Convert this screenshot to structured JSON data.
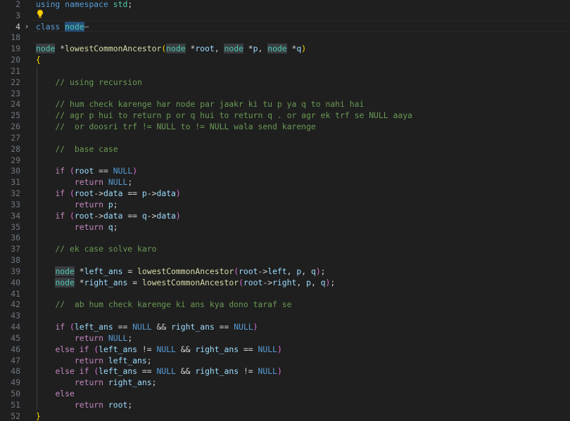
{
  "editor": {
    "accent_keyword": "#569cd6",
    "accent_comment": "#6a9955",
    "accent_type": "#4ec9b0",
    "accent_function": "#dcdcaa",
    "accent_variable": "#9cdcfe"
  },
  "lines": [
    {
      "n": "2",
      "tokens": [
        [
          "kw",
          "using"
        ],
        [
          "plain",
          " "
        ],
        [
          "kw",
          "namespace"
        ],
        [
          "plain",
          " "
        ],
        [
          "ty",
          "std"
        ],
        [
          "plain",
          ";"
        ]
      ]
    },
    {
      "n": "3",
      "tokens": []
    },
    {
      "n": "4",
      "tokens": [
        [
          "kw",
          "class"
        ],
        [
          "plain",
          " "
        ],
        [
          "tysel",
          "node"
        ],
        [
          "ell",
          "⋯"
        ]
      ],
      "fold": "›",
      "active": true
    },
    {
      "n": "18",
      "tokens": []
    },
    {
      "n": "19",
      "tokens": [
        [
          "tyhl",
          "node"
        ],
        [
          "plain",
          " "
        ],
        [
          "op",
          "*"
        ],
        [
          "fn",
          "lowestCommonAncestor"
        ],
        [
          "br",
          "("
        ],
        [
          "tyhl",
          "node"
        ],
        [
          "plain",
          " "
        ],
        [
          "op",
          "*"
        ],
        [
          "var",
          "root"
        ],
        [
          "plain",
          ", "
        ],
        [
          "tyhl",
          "node"
        ],
        [
          "plain",
          " "
        ],
        [
          "op",
          "*"
        ],
        [
          "var",
          "p"
        ],
        [
          "plain",
          ", "
        ],
        [
          "tyhl",
          "node"
        ],
        [
          "plain",
          " "
        ],
        [
          "op",
          "*"
        ],
        [
          "var",
          "q"
        ],
        [
          "br",
          ")"
        ]
      ]
    },
    {
      "n": "20",
      "tokens": [
        [
          "br",
          "{"
        ]
      ]
    },
    {
      "n": "21",
      "tokens": []
    },
    {
      "n": "22",
      "tokens": [
        [
          "plain",
          "    "
        ],
        [
          "cm",
          "// using recursion"
        ]
      ]
    },
    {
      "n": "23",
      "tokens": []
    },
    {
      "n": "24",
      "tokens": [
        [
          "plain",
          "    "
        ],
        [
          "cm",
          "// hum check karenge har node par jaakr ki tu p ya q to nahi hai"
        ]
      ]
    },
    {
      "n": "25",
      "tokens": [
        [
          "plain",
          "    "
        ],
        [
          "cm",
          "// agr p hui to return p or q hui to return q . or agr ek trf se NULL aaya"
        ]
      ]
    },
    {
      "n": "26",
      "tokens": [
        [
          "plain",
          "    "
        ],
        [
          "cm",
          "//  or doosri trf != NULL to != NULL wala send karenge"
        ]
      ]
    },
    {
      "n": "27",
      "tokens": []
    },
    {
      "n": "28",
      "tokens": [
        [
          "plain",
          "    "
        ],
        [
          "cm",
          "//  base case"
        ]
      ]
    },
    {
      "n": "29",
      "tokens": []
    },
    {
      "n": "30",
      "tokens": [
        [
          "plain",
          "    "
        ],
        [
          "ctl",
          "if"
        ],
        [
          "plain",
          " "
        ],
        [
          "br2",
          "("
        ],
        [
          "var",
          "root"
        ],
        [
          "plain",
          " "
        ],
        [
          "op",
          "=="
        ],
        [
          "plain",
          " "
        ],
        [
          "kw",
          "NULL"
        ],
        [
          "br2",
          ")"
        ]
      ]
    },
    {
      "n": "31",
      "tokens": [
        [
          "plain",
          "        "
        ],
        [
          "ctl",
          "return"
        ],
        [
          "plain",
          " "
        ],
        [
          "kw",
          "NULL"
        ],
        [
          "plain",
          ";"
        ]
      ]
    },
    {
      "n": "32",
      "tokens": [
        [
          "plain",
          "    "
        ],
        [
          "ctl",
          "if"
        ],
        [
          "plain",
          " "
        ],
        [
          "br2",
          "("
        ],
        [
          "var",
          "root"
        ],
        [
          "op",
          "->"
        ],
        [
          "var",
          "data"
        ],
        [
          "plain",
          " "
        ],
        [
          "op",
          "=="
        ],
        [
          "plain",
          " "
        ],
        [
          "var",
          "p"
        ],
        [
          "op",
          "->"
        ],
        [
          "var",
          "data"
        ],
        [
          "br2",
          ")"
        ]
      ]
    },
    {
      "n": "33",
      "tokens": [
        [
          "plain",
          "        "
        ],
        [
          "ctl",
          "return"
        ],
        [
          "plain",
          " "
        ],
        [
          "var",
          "p"
        ],
        [
          "plain",
          ";"
        ]
      ]
    },
    {
      "n": "34",
      "tokens": [
        [
          "plain",
          "    "
        ],
        [
          "ctl",
          "if"
        ],
        [
          "plain",
          " "
        ],
        [
          "br2",
          "("
        ],
        [
          "var",
          "root"
        ],
        [
          "op",
          "->"
        ],
        [
          "var",
          "data"
        ],
        [
          "plain",
          " "
        ],
        [
          "op",
          "=="
        ],
        [
          "plain",
          " "
        ],
        [
          "var",
          "q"
        ],
        [
          "op",
          "->"
        ],
        [
          "var",
          "data"
        ],
        [
          "br2",
          ")"
        ]
      ]
    },
    {
      "n": "35",
      "tokens": [
        [
          "plain",
          "        "
        ],
        [
          "ctl",
          "return"
        ],
        [
          "plain",
          " "
        ],
        [
          "var",
          "q"
        ],
        [
          "plain",
          ";"
        ]
      ]
    },
    {
      "n": "36",
      "tokens": []
    },
    {
      "n": "37",
      "tokens": [
        [
          "plain",
          "    "
        ],
        [
          "cm",
          "// ek case solve karo"
        ]
      ]
    },
    {
      "n": "38",
      "tokens": []
    },
    {
      "n": "39",
      "tokens": [
        [
          "plain",
          "    "
        ],
        [
          "tyhl",
          "node"
        ],
        [
          "plain",
          " "
        ],
        [
          "op",
          "*"
        ],
        [
          "var",
          "left_ans"
        ],
        [
          "plain",
          " "
        ],
        [
          "op",
          "="
        ],
        [
          "plain",
          " "
        ],
        [
          "fn",
          "lowestCommonAncestor"
        ],
        [
          "br2",
          "("
        ],
        [
          "var",
          "root"
        ],
        [
          "op",
          "->"
        ],
        [
          "var",
          "left"
        ],
        [
          "plain",
          ", "
        ],
        [
          "var",
          "p"
        ],
        [
          "plain",
          ", "
        ],
        [
          "var",
          "q"
        ],
        [
          "br2",
          ")"
        ],
        [
          "plain",
          ";"
        ]
      ]
    },
    {
      "n": "40",
      "tokens": [
        [
          "plain",
          "    "
        ],
        [
          "tyhl",
          "node"
        ],
        [
          "plain",
          " "
        ],
        [
          "op",
          "*"
        ],
        [
          "var",
          "right_ans"
        ],
        [
          "plain",
          " "
        ],
        [
          "op",
          "="
        ],
        [
          "plain",
          " "
        ],
        [
          "fn",
          "lowestCommonAncestor"
        ],
        [
          "br2",
          "("
        ],
        [
          "var",
          "root"
        ],
        [
          "op",
          "->"
        ],
        [
          "var",
          "right"
        ],
        [
          "plain",
          ", "
        ],
        [
          "var",
          "p"
        ],
        [
          "plain",
          ", "
        ],
        [
          "var",
          "q"
        ],
        [
          "br2",
          ")"
        ],
        [
          "plain",
          ";"
        ]
      ]
    },
    {
      "n": "41",
      "tokens": []
    },
    {
      "n": "42",
      "tokens": [
        [
          "plain",
          "    "
        ],
        [
          "cm",
          "//  ab hum check karenge ki ans kya dono taraf se"
        ]
      ]
    },
    {
      "n": "43",
      "tokens": []
    },
    {
      "n": "44",
      "tokens": [
        [
          "plain",
          "    "
        ],
        [
          "ctl",
          "if"
        ],
        [
          "plain",
          " "
        ],
        [
          "br2",
          "("
        ],
        [
          "var",
          "left_ans"
        ],
        [
          "plain",
          " "
        ],
        [
          "op",
          "=="
        ],
        [
          "plain",
          " "
        ],
        [
          "kw",
          "NULL"
        ],
        [
          "plain",
          " "
        ],
        [
          "op",
          "&&"
        ],
        [
          "plain",
          " "
        ],
        [
          "var",
          "right_ans"
        ],
        [
          "plain",
          " "
        ],
        [
          "op",
          "=="
        ],
        [
          "plain",
          " "
        ],
        [
          "kw",
          "NULL"
        ],
        [
          "br2",
          ")"
        ]
      ]
    },
    {
      "n": "45",
      "tokens": [
        [
          "plain",
          "        "
        ],
        [
          "ctl",
          "return"
        ],
        [
          "plain",
          " "
        ],
        [
          "kw",
          "NULL"
        ],
        [
          "plain",
          ";"
        ]
      ]
    },
    {
      "n": "46",
      "tokens": [
        [
          "plain",
          "    "
        ],
        [
          "ctl",
          "else"
        ],
        [
          "plain",
          " "
        ],
        [
          "ctl",
          "if"
        ],
        [
          "plain",
          " "
        ],
        [
          "br2",
          "("
        ],
        [
          "var",
          "left_ans"
        ],
        [
          "plain",
          " "
        ],
        [
          "op",
          "!="
        ],
        [
          "plain",
          " "
        ],
        [
          "kw",
          "NULL"
        ],
        [
          "plain",
          " "
        ],
        [
          "op",
          "&&"
        ],
        [
          "plain",
          " "
        ],
        [
          "var",
          "right_ans"
        ],
        [
          "plain",
          " "
        ],
        [
          "op",
          "=="
        ],
        [
          "plain",
          " "
        ],
        [
          "kw",
          "NULL"
        ],
        [
          "br2",
          ")"
        ]
      ]
    },
    {
      "n": "47",
      "tokens": [
        [
          "plain",
          "        "
        ],
        [
          "ctl",
          "return"
        ],
        [
          "plain",
          " "
        ],
        [
          "var",
          "left_ans"
        ],
        [
          "plain",
          ";"
        ]
      ]
    },
    {
      "n": "48",
      "tokens": [
        [
          "plain",
          "    "
        ],
        [
          "ctl",
          "else"
        ],
        [
          "plain",
          " "
        ],
        [
          "ctl",
          "if"
        ],
        [
          "plain",
          " "
        ],
        [
          "br2",
          "("
        ],
        [
          "var",
          "left_ans"
        ],
        [
          "plain",
          " "
        ],
        [
          "op",
          "=="
        ],
        [
          "plain",
          " "
        ],
        [
          "kw",
          "NULL"
        ],
        [
          "plain",
          " "
        ],
        [
          "op",
          "&&"
        ],
        [
          "plain",
          " "
        ],
        [
          "var",
          "right_ans"
        ],
        [
          "plain",
          " "
        ],
        [
          "op",
          "!="
        ],
        [
          "plain",
          " "
        ],
        [
          "kw",
          "NULL"
        ],
        [
          "br2",
          ")"
        ]
      ]
    },
    {
      "n": "49",
      "tokens": [
        [
          "plain",
          "        "
        ],
        [
          "ctl",
          "return"
        ],
        [
          "plain",
          " "
        ],
        [
          "var",
          "right_ans"
        ],
        [
          "plain",
          ";"
        ]
      ]
    },
    {
      "n": "50",
      "tokens": [
        [
          "plain",
          "    "
        ],
        [
          "ctl",
          "else"
        ]
      ]
    },
    {
      "n": "51",
      "tokens": [
        [
          "plain",
          "        "
        ],
        [
          "ctl",
          "return"
        ],
        [
          "plain",
          " "
        ],
        [
          "var",
          "root"
        ],
        [
          "plain",
          ";"
        ]
      ]
    },
    {
      "n": "52",
      "tokens": [
        [
          "br",
          "}"
        ]
      ]
    }
  ]
}
